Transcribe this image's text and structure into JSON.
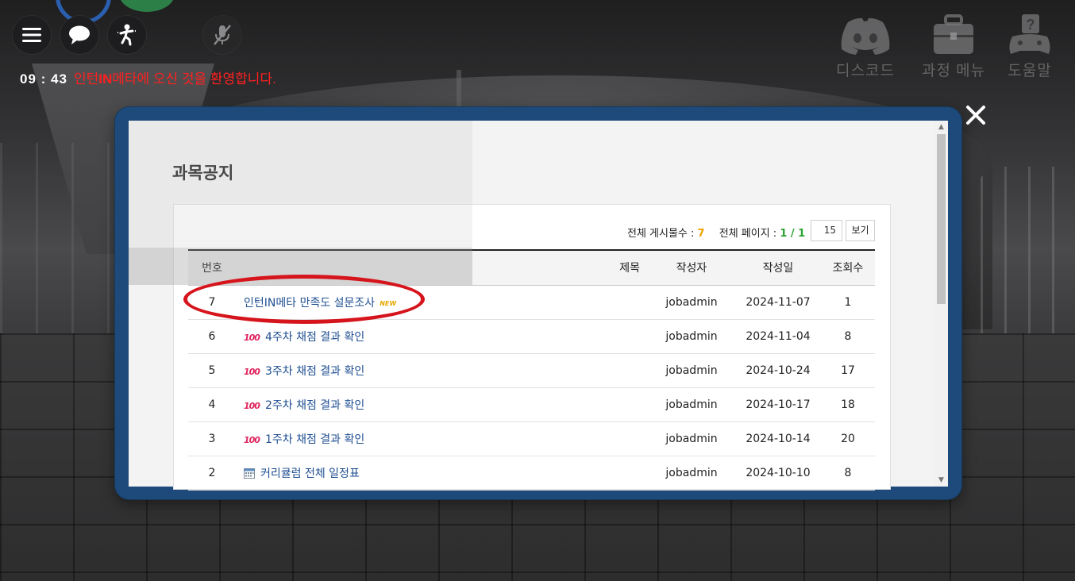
{
  "hud": {
    "timer": "09 : 43",
    "welcome_pre": "인턴",
    "welcome_bold": "IN",
    "welcome_post": "메타에 오신 것을 환영합니다.",
    "menu_icon": "hamburger-menu-icon",
    "chat_icon": "chat-bubble-icon",
    "action_icon": "person-action-icon",
    "mic_icon": "microphone-muted-icon"
  },
  "top_right": [
    {
      "label": "디스코드",
      "icon": "discord-icon"
    },
    {
      "label": "과정 메뉴",
      "icon": "briefcase-icon"
    },
    {
      "label": "도움말",
      "icon": "help-gamepad-icon"
    }
  ],
  "modal": {
    "title": "과목공지",
    "summary": {
      "total_label": "전체 게시물수 : ",
      "total_value": "7",
      "pages_label": "전체 페이지 : ",
      "pages_value": "1 / 1"
    },
    "page_size": "15",
    "view_button": "보기",
    "columns": {
      "num": "번호",
      "title": "제목",
      "author": "작성자",
      "date": "작성일",
      "views": "조회수"
    },
    "rows": [
      {
        "num": "7",
        "icon": "",
        "title": "인턴IN메타 만족도 설문조사",
        "badge": "NEW",
        "author": "jobadmin",
        "date": "2024-11-07",
        "views": "1"
      },
      {
        "num": "6",
        "icon": "100-emoji-icon",
        "icon_text": "100",
        "title": "4주차 채점 결과 확인",
        "badge": "",
        "author": "jobadmin",
        "date": "2024-11-04",
        "views": "8"
      },
      {
        "num": "5",
        "icon": "100-emoji-icon",
        "icon_text": "100",
        "title": "3주차 채점 결과 확인",
        "badge": "",
        "author": "jobadmin",
        "date": "2024-10-24",
        "views": "17"
      },
      {
        "num": "4",
        "icon": "100-emoji-icon",
        "icon_text": "100",
        "title": "2주차 채점 결과 확인",
        "badge": "",
        "author": "jobadmin",
        "date": "2024-10-17",
        "views": "18"
      },
      {
        "num": "3",
        "icon": "100-emoji-icon",
        "icon_text": "100",
        "title": "1주차 채점 결과 확인",
        "badge": "",
        "author": "jobadmin",
        "date": "2024-10-14",
        "views": "20"
      },
      {
        "num": "2",
        "icon": "calendar-icon",
        "icon_text": "",
        "title": "커리큘럼 전체 일정표",
        "badge": "",
        "author": "jobadmin",
        "date": "2024-10-10",
        "views": "8"
      }
    ],
    "close_icon": "close-icon"
  },
  "colors": {
    "modal_frame": "#1d4a7a",
    "welcome_text": "#ff2020",
    "highlight": "#d6141c",
    "link": "#1f4f91",
    "count_orange": "#f0a000",
    "page_green": "#2aa030"
  }
}
